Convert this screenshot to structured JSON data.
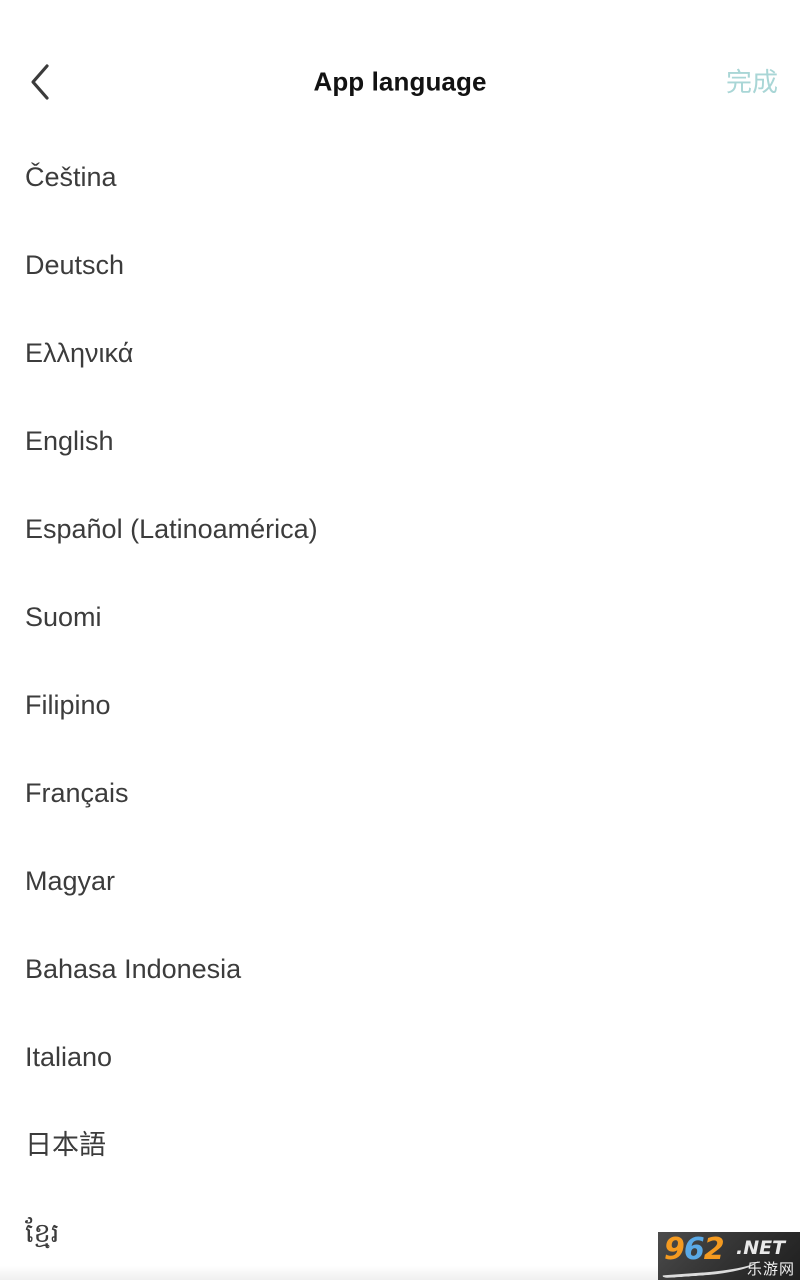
{
  "header": {
    "back_icon": "chevron-left-icon",
    "title": "App language",
    "done_label": "完成",
    "done_color": "#a9d6d6",
    "title_color": "#121212"
  },
  "list": {
    "text_color": "#3c3c3c",
    "items": [
      {
        "label": "Čeština"
      },
      {
        "label": "Deutsch"
      },
      {
        "label": "Ελληνικά"
      },
      {
        "label": "English"
      },
      {
        "label": "Español (Latinoamérica)"
      },
      {
        "label": "Suomi"
      },
      {
        "label": "Filipino"
      },
      {
        "label": "Français"
      },
      {
        "label": "Magyar"
      },
      {
        "label": "Bahasa Indonesia"
      },
      {
        "label": "Italiano"
      },
      {
        "label": "日本語"
      },
      {
        "label": "ខ្មែរ"
      }
    ]
  },
  "watermark": {
    "digit1": "9",
    "digit2": "6",
    "digit3": "2",
    "suffix": ".NET",
    "subtitle": "乐游网",
    "color_digit1": "#f49a20",
    "color_digit2": "#5aa9e6",
    "color_digit3": "#f49a20"
  }
}
